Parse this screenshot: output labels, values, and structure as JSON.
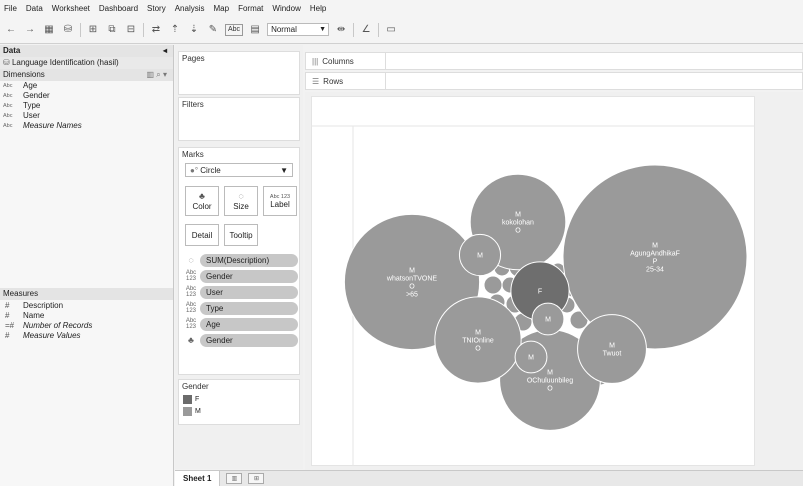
{
  "menu": [
    "File",
    "Data",
    "Worksheet",
    "Dashboard",
    "Story",
    "Analysis",
    "Map",
    "Format",
    "Window",
    "Help"
  ],
  "toolbar": {
    "abc_label": "Abc",
    "fit_value": "Normal"
  },
  "data_pane": {
    "header": "Data",
    "source": "Language Identification (hasil)",
    "dimensions_header": "Dimensions",
    "dimensions": [
      {
        "type": "Abc",
        "name": "Age"
      },
      {
        "type": "Abc",
        "name": "Gender"
      },
      {
        "type": "Abc",
        "name": "Type"
      },
      {
        "type": "Abc",
        "name": "User"
      },
      {
        "type": "Abc",
        "name": "Measure Names"
      }
    ],
    "measures_header": "Measures",
    "measures": [
      {
        "type": "#",
        "name": "Description"
      },
      {
        "type": "#",
        "name": "Name"
      },
      {
        "type": "=#",
        "name": "Number of Records"
      },
      {
        "type": "#",
        "name": "Measure Values"
      }
    ]
  },
  "pages_label": "Pages",
  "filters_label": "Filters",
  "marks": {
    "title": "Marks",
    "mark_type": "Circle",
    "buttons": {
      "color": "Color",
      "size": "Size",
      "label": "Label",
      "detail": "Detail",
      "tooltip": "Tooltip"
    },
    "label_icon": "Abc 123",
    "pills": [
      {
        "icon": "size-icon",
        "type": "",
        "text": "SUM(Description)"
      },
      {
        "icon": "label-icon",
        "type": "Abc 123",
        "text": "Gender"
      },
      {
        "icon": "label-icon",
        "type": "Abc 123",
        "text": "User"
      },
      {
        "icon": "label-icon",
        "type": "Abc 123",
        "text": "Type"
      },
      {
        "icon": "label-icon",
        "type": "Abc 123",
        "text": "Age"
      },
      {
        "icon": "color-icon",
        "type": "",
        "text": "Gender"
      }
    ]
  },
  "legend": {
    "title": "Gender",
    "items": [
      {
        "label": "F",
        "color": "#6b6b6b"
      },
      {
        "label": "M",
        "color": "#9a9a9a"
      }
    ]
  },
  "shelves": {
    "columns": "Columns",
    "rows": "Rows"
  },
  "sheet_tab": "Sheet 1",
  "colors": {
    "bubble_m": "#9a9a9a",
    "bubble_f": "#6e6e6e"
  },
  "chart_data": {
    "type": "packed-bubble",
    "size_measure": "SUM(Description)",
    "color_dimension": "Gender",
    "label_fields": [
      "Gender",
      "User",
      "Type",
      "Age"
    ],
    "bubbles": [
      {
        "gender": "M",
        "user": "AgungAndhikaF",
        "type": "P",
        "age": "25-34",
        "relative_size": 1.0
      },
      {
        "gender": "M",
        "user": "whatsonTVONE",
        "type": "O",
        "age": ">65",
        "relative_size": 0.54
      },
      {
        "gender": "M",
        "user": "kokolohan",
        "type": "O",
        "age": "",
        "relative_size": 0.27
      },
      {
        "gender": "M",
        "user": "OChuluunbileg",
        "type": "O",
        "age": "",
        "relative_size": 0.3
      },
      {
        "gender": "M",
        "user": "TNIOnline",
        "type": "O",
        "age": "",
        "relative_size": 0.22
      },
      {
        "gender": "M",
        "user": "Twuot",
        "type": "",
        "age": "",
        "relative_size": 0.14
      },
      {
        "gender": "F",
        "user": "",
        "type": "",
        "age": "",
        "relative_size": 0.1
      },
      {
        "gender": "M",
        "user": "",
        "type": "",
        "age": "",
        "relative_size": 0.05
      },
      {
        "gender": "M",
        "user": "",
        "type": "",
        "age": "",
        "relative_size": 0.03
      },
      {
        "gender": "M",
        "user": "",
        "type": "",
        "age": "",
        "relative_size": 0.03
      }
    ]
  }
}
